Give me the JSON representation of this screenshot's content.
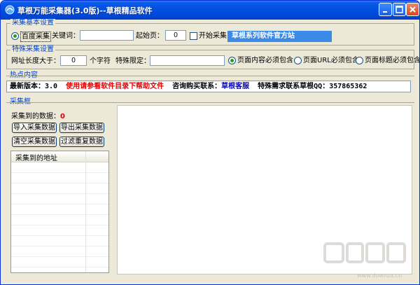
{
  "window": {
    "title": "草根万能采集器(3.0版)--草根精品软件"
  },
  "basic": {
    "title": "采集基本设置",
    "baidu_label": "百度采集",
    "keyword_label": "关键词：",
    "keyword_value": "",
    "start_page_label": "起始页：",
    "start_page_value": "0",
    "start_label": "开始采集",
    "site_link": "草根系列软件官方站"
  },
  "special": {
    "title": "特殊采集设置",
    "url_len_label": "网址长度大于：",
    "url_len_value": "0",
    "chars_label": "个字符",
    "limit_label": "特殊限定：",
    "limit_value": "",
    "opt_content": "页面内容必须包含",
    "opt_url": "页面URL必须包含",
    "opt_title": "页面标题必须包含"
  },
  "hot": {
    "title": "热点内容",
    "version": "最新版本：3.0",
    "help": "使用请参看软件目录下帮助文件",
    "contact_label": "咨询购买联系：",
    "contact_name": "草根客服",
    "special_label": "特殊需求联系草根QQ：357865362"
  },
  "collect": {
    "title": "采集框",
    "count_label": "采集到的数据：",
    "count_value": "0",
    "btn_import": "导入采集数据",
    "btn_export": "导出采集数据",
    "btn_clear": "清空采集数据",
    "btn_filter": "过滤重复数据",
    "list_header": "采集到的地址"
  },
  "colors": {
    "title_bar": "#0050e0",
    "group_title": "#0046d5",
    "link_bg": "#3c8ae8",
    "help_text": "#e00000",
    "contact_text": "#0000c0",
    "count_value": "#e00000"
  },
  "watermark": {
    "site": "www.downza.cn"
  }
}
